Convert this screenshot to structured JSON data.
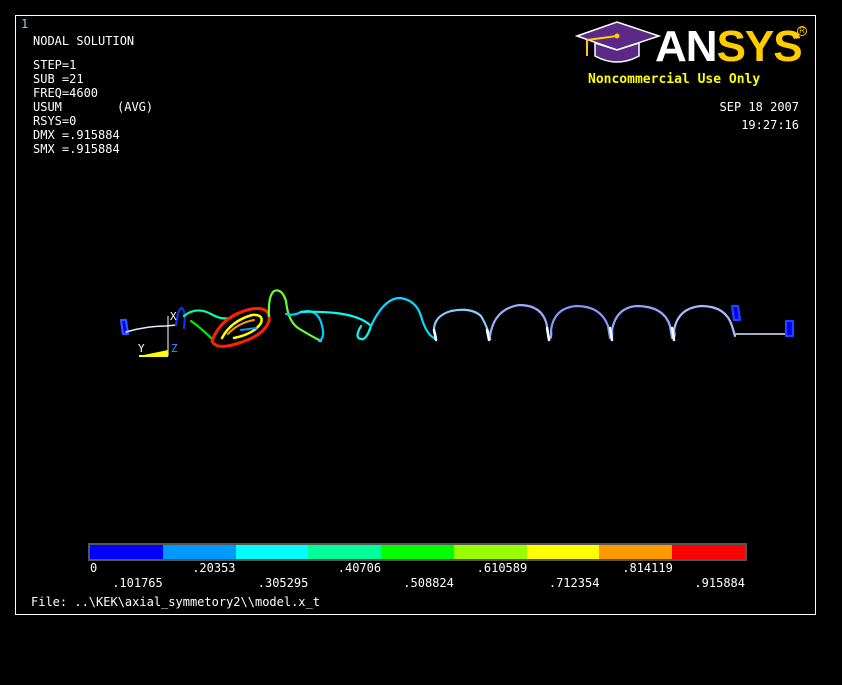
{
  "window": {
    "number": "1"
  },
  "info": {
    "title": "NODAL SOLUTION",
    "step": "STEP=1",
    "sub": "SUB =21",
    "freq": "FREQ=4600",
    "usum": "USUM",
    "avg": "(AVG)",
    "rsys": "RSYS=0",
    "dmx": "DMX =.915884",
    "smx": "SMX =.915884"
  },
  "logo": {
    "word_an": "AN",
    "word_sys": "SYS",
    "reg": "R",
    "license": "Noncommercial Use Only"
  },
  "timestamp": {
    "date": "SEP 18 2007",
    "time": "19:27:16"
  },
  "triad": {
    "y": "Y",
    "z": "Z",
    "x": "X"
  },
  "legend": {
    "colors": [
      "#0000ff",
      "#0099ff",
      "#00ffff",
      "#00ff99",
      "#00ff00",
      "#99ff00",
      "#ffff00",
      "#ff9900",
      "#ff0000"
    ],
    "labels_top": [
      "0",
      ".20353",
      ".40706",
      ".610589",
      ".814119"
    ],
    "labels_bottom": [
      ".101765",
      ".305295",
      ".508824",
      ".712354",
      ".915884"
    ]
  },
  "file": "File: ..\\KEK\\axial_symmetory2\\\\model.x_t"
}
